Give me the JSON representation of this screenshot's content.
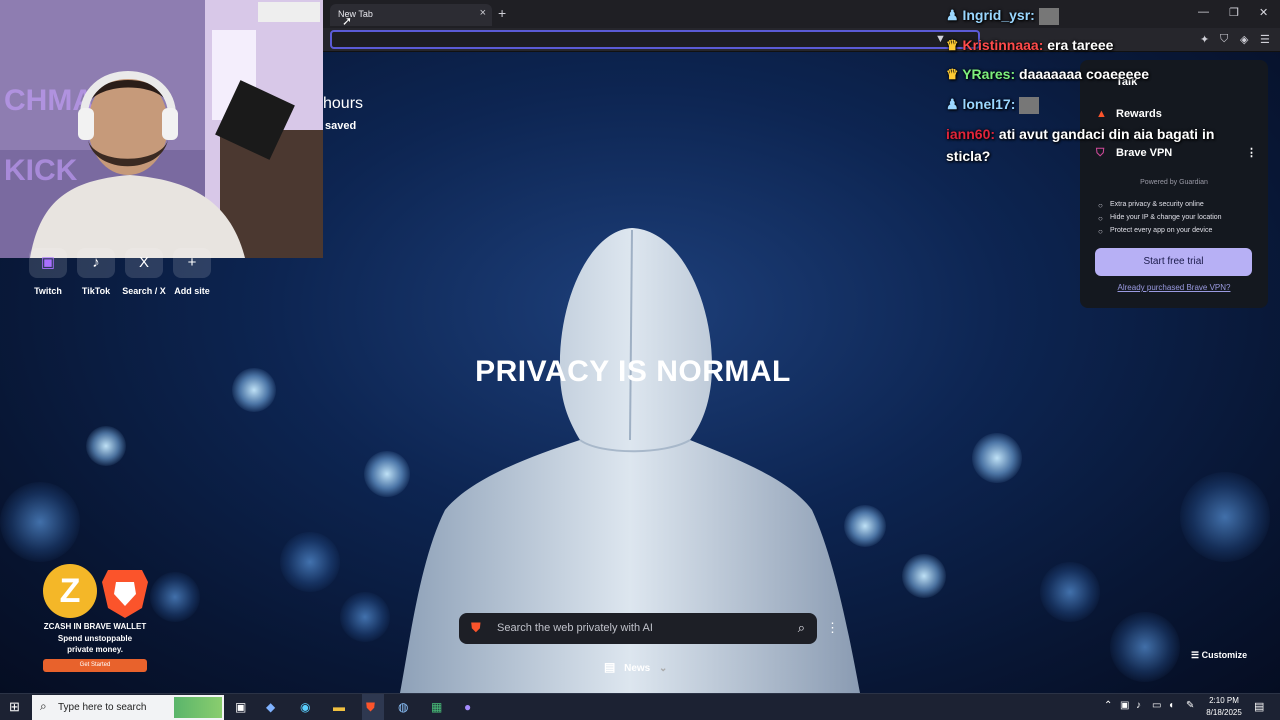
{
  "browser": {
    "tab_title": "New Tab",
    "tab_close": "×",
    "new_tab": "+"
  },
  "window_controls": {
    "minimize": "—",
    "restore": "❐",
    "close": "✕"
  },
  "stats": {
    "hours_label": "hours",
    "saved_label": "saved"
  },
  "shortcuts": [
    {
      "label": "Twitch",
      "icon": "twitch-icon",
      "glyph": "▣"
    },
    {
      "label": "TikTok",
      "icon": "tiktok-icon",
      "glyph": "♪"
    },
    {
      "label": "Search / X",
      "icon": "x-icon",
      "glyph": "X"
    },
    {
      "label": "Add site",
      "icon": "plus-icon",
      "glyph": "+"
    }
  ],
  "chat": [
    {
      "user": "Ingrid_ysr:",
      "message": "",
      "user_color": "#9ad7ff"
    },
    {
      "user": "Kristinnaaa:",
      "message": "era tareee",
      "user_color": "#ff4b4b"
    },
    {
      "user": "YRares:",
      "message": "daaaaaaa coaeeeee",
      "user_color": "#7df07d"
    },
    {
      "user": "lonel17:",
      "message": "",
      "user_color": "#9ad7ff"
    },
    {
      "user": "iann60:",
      "message": "ati avut gandaci din aia bagati in",
      "user_color": "#e0243a"
    },
    {
      "user": "",
      "message": "sticla?",
      "user_color": "#ffffff"
    }
  ],
  "vpn_panel": {
    "talk_label": "Talk",
    "rewards_label": "Rewards",
    "vpn_title": "Brave VPN",
    "powered_by": "Powered by",
    "provider": "Guardian",
    "features": [
      "Extra privacy & security online",
      "Hide your IP & change your location",
      "Protect every app on your device"
    ],
    "cta": "Start free trial",
    "already_link": "Already purchased Brave VPN?",
    "menu_glyph": "⋮"
  },
  "hero": {
    "headline": "PRIVACY IS NORMAL"
  },
  "search": {
    "placeholder": "Search the web privately with AI",
    "menu_glyph": "⋮"
  },
  "news_label": "News",
  "customize_label": "Customize",
  "wallet_promo": {
    "title": "ZCASH IN BRAVE WALLET",
    "line1": "Spend unstoppable",
    "line2": "private money.",
    "button": "Get Started",
    "zcash_glyph": "Z"
  },
  "taskbar": {
    "search_placeholder": "Type here to search",
    "time": "2:10 PM",
    "date": "8/18/2025"
  },
  "colors": {
    "accent": "#5b5bd6",
    "vpn_button": "#b7b0f5",
    "wallet_button": "#e8622c",
    "zcash": "#f4b728",
    "brave": "#fb542b"
  }
}
